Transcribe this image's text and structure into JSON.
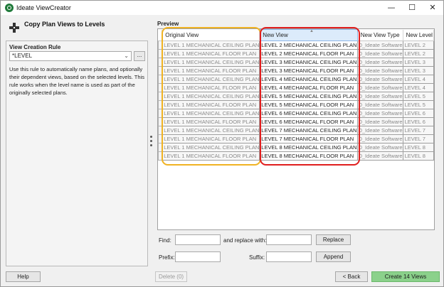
{
  "window": {
    "title": "Ideate ViewCreator",
    "minimize": "—",
    "maximize": "☐",
    "close": "✕"
  },
  "left": {
    "heading": "Copy Plan Views to Levels",
    "rule_label": "View Creation Rule",
    "rule_value": "*LEVEL",
    "rule_browse": "...",
    "description": "Use this rule to automatically name plans, and optionally their dependent views, based on the selected levels. This rule works when the level name is used as part of the originally selected plans."
  },
  "preview": {
    "label": "Preview",
    "columns": [
      "Original View",
      "New View",
      "New View Type",
      "New Level"
    ],
    "rows": [
      [
        "LEVEL 1 MECHANICAL CEILING PLAN",
        "LEVEL 2 MECHANICAL CEILING PLAN",
        "0_Ideate Software",
        "LEVEL 2"
      ],
      [
        "LEVEL 1 MECHANICAL FLOOR PLAN",
        "LEVEL 2 MECHANICAL FLOOR PLAN",
        "0_Ideate Software",
        "LEVEL 2"
      ],
      [
        "LEVEL 1 MECHANICAL CEILING PLAN",
        "LEVEL 3 MECHANICAL CEILING PLAN",
        "0_Ideate Software",
        "LEVEL 3"
      ],
      [
        "LEVEL 1 MECHANICAL FLOOR PLAN",
        "LEVEL 3 MECHANICAL FLOOR PLAN",
        "0_Ideate Software",
        "LEVEL 3"
      ],
      [
        "LEVEL 1 MECHANICAL CEILING PLAN",
        "LEVEL 4 MECHANICAL CEILING PLAN",
        "0_Ideate Software",
        "LEVEL 4"
      ],
      [
        "LEVEL 1 MECHANICAL FLOOR PLAN",
        "LEVEL 4 MECHANICAL FLOOR PLAN",
        "0_Ideate Software",
        "LEVEL 4"
      ],
      [
        "LEVEL 1 MECHANICAL CEILING PLAN",
        "LEVEL 5 MECHANICAL CEILING PLAN",
        "0_Ideate Software",
        "LEVEL 5"
      ],
      [
        "LEVEL 1 MECHANICAL FLOOR PLAN",
        "LEVEL 5 MECHANICAL FLOOR PLAN",
        "0_Ideate Software",
        "LEVEL 5"
      ],
      [
        "LEVEL 1 MECHANICAL CEILING PLAN",
        "LEVEL 6 MECHANICAL CEILING PLAN",
        "0_Ideate Software",
        "LEVEL 6"
      ],
      [
        "LEVEL 1 MECHANICAL FLOOR PLAN",
        "LEVEL 6 MECHANICAL FLOOR PLAN",
        "0_Ideate Software",
        "LEVEL 6"
      ],
      [
        "LEVEL 1 MECHANICAL CEILING PLAN",
        "LEVEL 7 MECHANICAL CEILING PLAN",
        "0_Ideate Software",
        "LEVEL 7"
      ],
      [
        "LEVEL 1 MECHANICAL FLOOR PLAN",
        "LEVEL 7 MECHANICAL FLOOR PLAN",
        "0_Ideate Software",
        "LEVEL 7"
      ],
      [
        "LEVEL 1 MECHANICAL CEILING PLAN",
        "LEVEL 8 MECHANICAL CEILING PLAN",
        "0_Ideate Software",
        "LEVEL 8"
      ],
      [
        "LEVEL 1 MECHANICAL FLOOR PLAN",
        "LEVEL 8 MECHANICAL FLOOR PLAN",
        "0_Ideate Software",
        "LEVEL 8"
      ]
    ]
  },
  "find_replace": {
    "find_label": "Find:",
    "find_value": "",
    "replace_label": "and replace with:",
    "replace_value": "",
    "replace_button": "Replace",
    "prefix_label": "Prefix:",
    "prefix_value": "",
    "suffix_label": "Suffix:",
    "suffix_value": "",
    "append_button": "Append"
  },
  "footer": {
    "help": "Help",
    "delete": "Delete (0)",
    "back": "< Back",
    "create": "Create 14 Views"
  },
  "colors": {
    "highlight_original": "#f0b323",
    "highlight_new": "#e01e1e",
    "create_button": "#8bd18b"
  }
}
